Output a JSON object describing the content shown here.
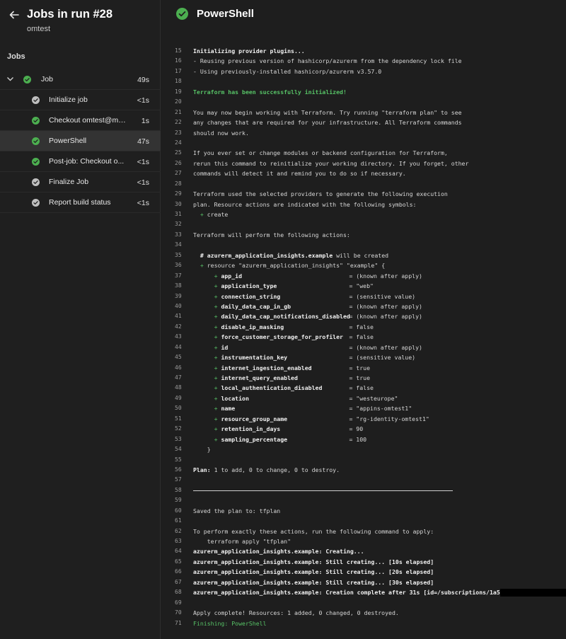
{
  "colors": {
    "success": "#4caf50",
    "step_done": "#bfbfbf",
    "selected_row": "#333333"
  },
  "header": {
    "back_icon": "arrow-left-icon",
    "title": "Jobs in run #28",
    "subtitle": "omtest"
  },
  "sidebar": {
    "section_label": "Jobs",
    "job": {
      "label": "Job",
      "duration": "49s",
      "status": "success"
    },
    "steps": [
      {
        "label": "Initialize job",
        "duration": "<1s",
        "status": "done"
      },
      {
        "label": "Checkout omtest@mai...",
        "duration": "1s",
        "status": "success"
      },
      {
        "label": "PowerShell",
        "duration": "47s",
        "status": "success",
        "selected": true
      },
      {
        "label": "Post-job: Checkout o...",
        "duration": "<1s",
        "status": "success"
      },
      {
        "label": "Finalize Job",
        "duration": "<1s",
        "status": "done"
      },
      {
        "label": "Report build status",
        "duration": "<1s",
        "status": "done"
      }
    ]
  },
  "main": {
    "title": "PowerShell",
    "log": [
      {
        "n": "15",
        "t": "Initializing provider plugins...",
        "style": "bold"
      },
      {
        "n": "16",
        "t": "- Reusing previous version of hashicorp/azurerm from the dependency lock file"
      },
      {
        "n": "17",
        "t": "- Using previously-installed hashicorp/azurerm v3.57.0"
      },
      {
        "n": "18",
        "t": ""
      },
      {
        "n": "19",
        "t": "Terraform has been successfully initialized!",
        "style": "green"
      },
      {
        "n": "20",
        "t": ""
      },
      {
        "n": "21",
        "t": "You may now begin working with Terraform. Try running \"terraform plan\" to see"
      },
      {
        "n": "22",
        "t": "any changes that are required for your infrastructure. All Terraform commands"
      },
      {
        "n": "23",
        "t": "should now work."
      },
      {
        "n": "24",
        "t": ""
      },
      {
        "n": "25",
        "t": "If you ever set or change modules or backend configuration for Terraform,"
      },
      {
        "n": "26",
        "t": "rerun this command to reinitialize your working directory. If you forget, other"
      },
      {
        "n": "27",
        "t": "commands will detect it and remind you to do so if necessary."
      },
      {
        "n": "28",
        "t": ""
      },
      {
        "n": "29",
        "t": "Terraform used the selected providers to generate the following execution"
      },
      {
        "n": "30",
        "t": "plan. Resource actions are indicated with the following symbols:"
      },
      {
        "n": "31",
        "t": "  + create",
        "style": "create"
      },
      {
        "n": "32",
        "t": ""
      },
      {
        "n": "33",
        "t": "Terraform will perform the following actions:"
      },
      {
        "n": "34",
        "t": ""
      },
      {
        "n": "35",
        "t": "  # azurerm_application_insights.example will be created",
        "style": "comment"
      },
      {
        "n": "36",
        "t": "  + resource \"azurerm_application_insights\" \"example\" {",
        "style": "resource"
      },
      {
        "n": "37",
        "attr": "app_id",
        "val": "= (known after apply)"
      },
      {
        "n": "38",
        "attr": "application_type",
        "val": "= \"web\""
      },
      {
        "n": "39",
        "attr": "connection_string",
        "val": "= (sensitive value)"
      },
      {
        "n": "40",
        "attr": "daily_data_cap_in_gb",
        "val": "= (known after apply)"
      },
      {
        "n": "41",
        "attr": "daily_data_cap_notifications_disabled",
        "val": "= (known after apply)"
      },
      {
        "n": "42",
        "attr": "disable_ip_masking",
        "val": "= false"
      },
      {
        "n": "43",
        "attr": "force_customer_storage_for_profiler",
        "val": "= false"
      },
      {
        "n": "44",
        "attr": "id",
        "val": "= (known after apply)"
      },
      {
        "n": "45",
        "attr": "instrumentation_key",
        "val": "= (sensitive value)"
      },
      {
        "n": "46",
        "attr": "internet_ingestion_enabled",
        "val": "= true"
      },
      {
        "n": "47",
        "attr": "internet_query_enabled",
        "val": "= true"
      },
      {
        "n": "48",
        "attr": "local_authentication_disabled",
        "val": "= false"
      },
      {
        "n": "49",
        "attr": "location",
        "val": "= \"westeurope\""
      },
      {
        "n": "50",
        "attr": "name",
        "val": "= \"appins-omtest1\""
      },
      {
        "n": "51",
        "attr": "resource_group_name",
        "val": "= \"rg-identity-omtest1\""
      },
      {
        "n": "52",
        "attr": "retention_in_days",
        "val": "= 90"
      },
      {
        "n": "53",
        "attr": "sampling_percentage",
        "val": "= 100"
      },
      {
        "n": "54",
        "t": "    }"
      },
      {
        "n": "55",
        "t": ""
      },
      {
        "n": "56",
        "t": " 1 to add, 0 to change, 0 to destroy.",
        "style": "plan",
        "prefix": "Plan:"
      },
      {
        "n": "57",
        "t": ""
      },
      {
        "n": "58",
        "t": "",
        "style": "rule"
      },
      {
        "n": "59",
        "t": ""
      },
      {
        "n": "60",
        "t": "Saved the plan to: tfplan"
      },
      {
        "n": "61",
        "t": ""
      },
      {
        "n": "62",
        "t": "To perform exactly these actions, run the following command to apply:"
      },
      {
        "n": "63",
        "t": "    terraform apply \"tfplan\""
      },
      {
        "n": "64",
        "t": "azurerm_application_insights.example: Creating...",
        "style": "bold"
      },
      {
        "n": "65",
        "t": "azurerm_application_insights.example: Still creating... [10s elapsed]",
        "style": "bold"
      },
      {
        "n": "66",
        "t": "azurerm_application_insights.example: Still creating... [20s elapsed]",
        "style": "bold"
      },
      {
        "n": "67",
        "t": "azurerm_application_insights.example: Still creating... [30s elapsed]",
        "style": "bold"
      },
      {
        "n": "68",
        "t": "azurerm_application_insights.example: Creation complete after 31s [id=/subscriptions/1a5",
        "style": "bold",
        "redacted": true
      },
      {
        "n": "69",
        "t": ""
      },
      {
        "n": "70",
        "t": "Apply complete! Resources: 1 added, 0 changed, 0 destroyed."
      },
      {
        "n": "71",
        "t": "Finishing: PowerShell",
        "style": "plain-green"
      }
    ]
  }
}
